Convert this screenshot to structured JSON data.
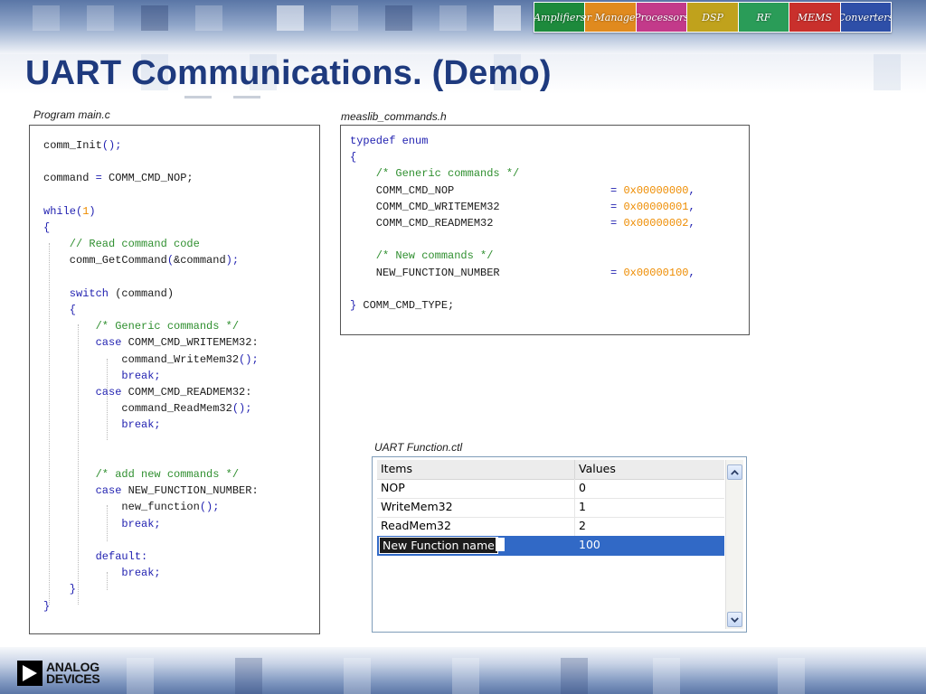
{
  "slide": {
    "title": "UART Communications. (Demo)"
  },
  "banner": {
    "segments": [
      "Amplifiers",
      "Power Management",
      "Processors",
      "DSP",
      "RF",
      "MEMS",
      "Converters"
    ],
    "colors": [
      "#1d8a3c",
      "#e08a1e",
      "#c33a8a",
      "#c0a21c",
      "#2a9c58",
      "#c9302c",
      "#2e4fa8"
    ]
  },
  "main_c": {
    "caption": "Program main.c",
    "lines": [
      [
        {
          "t": "comm_Init",
          "c": ""
        },
        {
          "t": "();",
          "c": "op"
        }
      ],
      [],
      [
        {
          "t": "command ",
          "c": ""
        },
        {
          "t": "=",
          "c": "op"
        },
        {
          "t": " COMM_CMD_NOP;",
          "c": ""
        }
      ],
      [],
      [
        {
          "t": "while",
          "c": "kw"
        },
        {
          "t": "(",
          "c": "op"
        },
        {
          "t": "1",
          "c": "num"
        },
        {
          "t": ")",
          "c": "op"
        }
      ],
      [
        {
          "t": "{",
          "c": "op"
        }
      ],
      [
        {
          "t": "    // Read command code",
          "c": "cm"
        }
      ],
      [
        {
          "t": "    comm_GetCommand",
          "c": ""
        },
        {
          "t": "(",
          "c": "op"
        },
        {
          "t": "&command",
          "c": ""
        },
        {
          "t": ");",
          "c": "op"
        }
      ],
      [],
      [
        {
          "t": "    switch ",
          "c": "kw"
        },
        {
          "t": "(command)",
          "c": ""
        }
      ],
      [
        {
          "t": "    {",
          "c": "op"
        }
      ],
      [
        {
          "t": "        /* Generic commands */",
          "c": "cm"
        }
      ],
      [
        {
          "t": "        case ",
          "c": "kw"
        },
        {
          "t": "COMM_CMD_WRITEMEM32:",
          "c": ""
        }
      ],
      [
        {
          "t": "            command_WriteMem32",
          "c": ""
        },
        {
          "t": "();",
          "c": "op"
        }
      ],
      [
        {
          "t": "            break;",
          "c": "kw"
        }
      ],
      [
        {
          "t": "        case ",
          "c": "kw"
        },
        {
          "t": "COMM_CMD_READMEM32:",
          "c": ""
        }
      ],
      [
        {
          "t": "            command_ReadMem32",
          "c": ""
        },
        {
          "t": "();",
          "c": "op"
        }
      ],
      [
        {
          "t": "            break;",
          "c": "kw"
        }
      ],
      [],
      [],
      [
        {
          "t": "        /* add new commands */",
          "c": "cm"
        }
      ],
      [
        {
          "t": "        case ",
          "c": "kw"
        },
        {
          "t": "NEW_FUNCTION_NUMBER:",
          "c": ""
        }
      ],
      [
        {
          "t": "            new_function",
          "c": ""
        },
        {
          "t": "();",
          "c": "op"
        }
      ],
      [
        {
          "t": "            break;",
          "c": "kw"
        }
      ],
      [],
      [
        {
          "t": "        default:",
          "c": "kw"
        }
      ],
      [
        {
          "t": "            break;",
          "c": "kw"
        }
      ],
      [
        {
          "t": "    }",
          "c": "op"
        }
      ],
      [
        {
          "t": "}",
          "c": "op"
        }
      ]
    ]
  },
  "measlib_h": {
    "caption": "measlib_commands.h",
    "lines": [
      [
        {
          "t": "typedef ",
          "c": "kw"
        },
        {
          "t": "enum",
          "c": "kw"
        }
      ],
      [
        {
          "t": "{",
          "c": "op"
        }
      ],
      [
        {
          "t": "    /* Generic commands */",
          "c": "cm"
        }
      ],
      [
        {
          "t": "    COMM_CMD_NOP                        ",
          "c": ""
        },
        {
          "t": "= ",
          "c": "op"
        },
        {
          "t": "0x00000000",
          "c": "num"
        },
        {
          "t": ",",
          "c": "op"
        }
      ],
      [
        {
          "t": "    COMM_CMD_WRITEMEM32                 ",
          "c": ""
        },
        {
          "t": "= ",
          "c": "op"
        },
        {
          "t": "0x00000001",
          "c": "num"
        },
        {
          "t": ",",
          "c": "op"
        }
      ],
      [
        {
          "t": "    COMM_CMD_READMEM32                  ",
          "c": ""
        },
        {
          "t": "= ",
          "c": "op"
        },
        {
          "t": "0x00000002",
          "c": "num"
        },
        {
          "t": ",",
          "c": "op"
        }
      ],
      [],
      [
        {
          "t": "    /* New commands */",
          "c": "cm"
        }
      ],
      [
        {
          "t": "    NEW_FUNCTION_NUMBER                 ",
          "c": ""
        },
        {
          "t": "= ",
          "c": "op"
        },
        {
          "t": "0x00000100",
          "c": "num"
        },
        {
          "t": ",",
          "c": "op"
        }
      ],
      [],
      [
        {
          "t": "} ",
          "c": "op"
        },
        {
          "t": "COMM_CMD_TYPE;",
          "c": ""
        }
      ]
    ]
  },
  "uart_ctl": {
    "caption": "UART Function.ctl",
    "headers": [
      "Items",
      "Values"
    ],
    "rows": [
      {
        "item": "NOP",
        "value": "0"
      },
      {
        "item": "WriteMem32",
        "value": "1"
      },
      {
        "item": "ReadMem32",
        "value": "2"
      }
    ],
    "editing_row": {
      "item": "New Function name",
      "value": "100"
    }
  },
  "footer": {
    "logo_line1": "ANALOG",
    "logo_line2": "DEVICES"
  }
}
